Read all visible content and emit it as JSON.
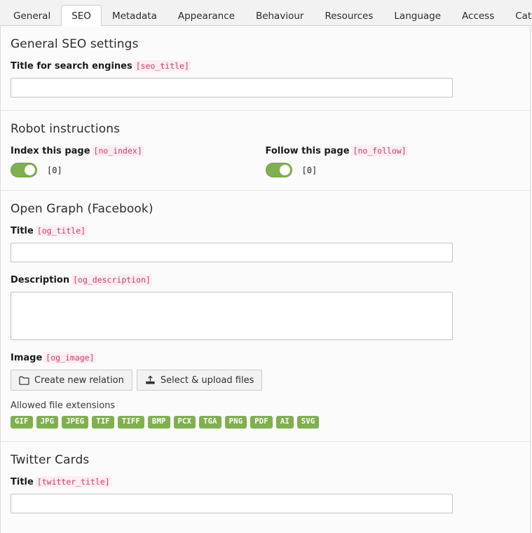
{
  "tabs": [
    {
      "label": "General",
      "active": false
    },
    {
      "label": "SEO",
      "active": true
    },
    {
      "label": "Metadata",
      "active": false
    },
    {
      "label": "Appearance",
      "active": false
    },
    {
      "label": "Behaviour",
      "active": false
    },
    {
      "label": "Resources",
      "active": false
    },
    {
      "label": "Language",
      "active": false
    },
    {
      "label": "Access",
      "active": false
    },
    {
      "label": "Categories",
      "active": false
    }
  ],
  "general_seo": {
    "title": "General SEO settings",
    "seo_title_label": "Title for search engines",
    "seo_title_code": "[seo_title]",
    "seo_title_value": "",
    "seo_title_placeholder": ""
  },
  "robot": {
    "title": "Robot instructions",
    "index": {
      "label": "Index this page",
      "code": "[no_index]",
      "value": "[0]",
      "state": "on"
    },
    "follow": {
      "label": "Follow this page",
      "code": "[no_follow]",
      "value": "[0]",
      "state": "on"
    }
  },
  "open_graph": {
    "title": "Open Graph (Facebook)",
    "og_title_label": "Title",
    "og_title_code": "[og_title]",
    "og_title_value": "",
    "og_description_label": "Description",
    "og_description_code": "[og_description]",
    "og_description_value": "",
    "og_image_label": "Image",
    "og_image_code": "[og_image]",
    "create_relation_button": "Create new relation",
    "select_upload_button": "Select & upload files",
    "allowed_caption": "Allowed file extensions",
    "allowed_extensions": [
      "GIF",
      "JPG",
      "JPEG",
      "TIF",
      "TIFF",
      "BMP",
      "PCX",
      "TGA",
      "PNG",
      "PDF",
      "AI",
      "SVG"
    ]
  },
  "twitter": {
    "title": "Twitter Cards",
    "twitter_title_label": "Title",
    "twitter_title_code": "[twitter_title]",
    "twitter_title_value": ""
  },
  "colors": {
    "accent_green": "#7fb04e",
    "code_pink": "#d6336c",
    "panel_bg": "#fbfbfb",
    "border": "#dcdcdc"
  }
}
